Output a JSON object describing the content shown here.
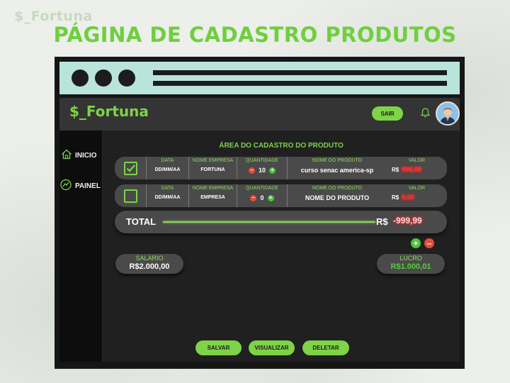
{
  "brand": {
    "top_logo": "$_Fortuna",
    "app_logo": "$_Fortuna"
  },
  "page_title": "PÁGINA DE CADASTRO PRODUTOS",
  "header": {
    "logout_label": "SAIR",
    "bell_icon": "bell-icon",
    "avatar_icon": "user-avatar"
  },
  "sidebar": {
    "items": [
      {
        "label": "INICIO",
        "icon": "home-icon"
      },
      {
        "label": "PAINEL",
        "icon": "panel-icon"
      }
    ]
  },
  "main": {
    "section_title": "ÁREA DO CADASTRO DO PRODUTO",
    "columns": {
      "data": "DATA",
      "empresa": "NOME EMPRESA",
      "quantidade": "QUANTIDADE",
      "produto": "NOME DO PRODUTO",
      "valor": "VALOR"
    },
    "rows": [
      {
        "checked": true,
        "data": "DD/MM/AA",
        "empresa": "FORTUNA",
        "quantidade": "10",
        "produto": "curso senac america-sp",
        "currency": "R$",
        "valor": "999,99"
      },
      {
        "checked": false,
        "data": "DD/MM/AA",
        "empresa": "EMPRESA",
        "quantidade": "0",
        "produto": "NOME DO PRODUTO",
        "currency": "R$",
        "valor": "0,00"
      }
    ],
    "total": {
      "label": "TOTAL",
      "currency": "R$",
      "value": "-999,99"
    },
    "salario": {
      "label": "SALARIO",
      "value": "R$2.000,00"
    },
    "lucro": {
      "label": "LUCRO",
      "value": "R$1.000,01"
    },
    "actions": {
      "save": "SALVAR",
      "view": "VISUALIZAR",
      "delete": "DELETAR"
    }
  },
  "colors": {
    "accent_green": "#7ed348",
    "danger_red": "#ff2f2f",
    "browser_bar": "#b8e4dc",
    "panel_dark": "#161616"
  }
}
